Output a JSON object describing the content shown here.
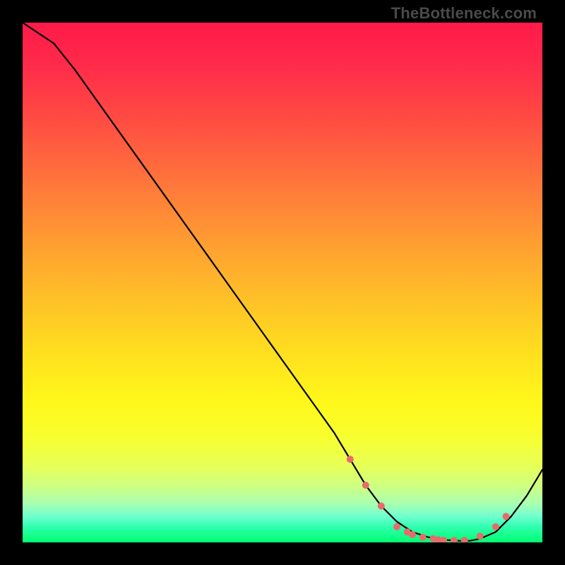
{
  "watermark": "TheBottleneck.com",
  "chart_data": {
    "type": "line",
    "title": "",
    "xlabel": "",
    "ylabel": "",
    "xlim": [
      0,
      100
    ],
    "ylim": [
      0,
      100
    ],
    "grid": false,
    "legend": false,
    "gradient_stops": [
      {
        "pos": 0,
        "color": "#ff1a4a"
      },
      {
        "pos": 20,
        "color": "#ff5042"
      },
      {
        "pos": 44,
        "color": "#ffa330"
      },
      {
        "pos": 65,
        "color": "#ffe31e"
      },
      {
        "pos": 80,
        "color": "#f7ff30"
      },
      {
        "pos": 92,
        "color": "#aaffb0"
      },
      {
        "pos": 100,
        "color": "#00ff70"
      }
    ],
    "series": [
      {
        "name": "bottleneck-curve",
        "color": "#000000",
        "x": [
          0,
          6,
          10,
          15,
          20,
          25,
          30,
          35,
          40,
          45,
          50,
          55,
          60,
          63,
          66,
          69,
          72,
          75,
          78,
          81,
          84,
          86,
          88,
          91,
          94,
          97,
          100
        ],
        "y": [
          100,
          96,
          91,
          84,
          77,
          70,
          63,
          56,
          49,
          42,
          35,
          28,
          21,
          16,
          11,
          7,
          4,
          2,
          1,
          0.5,
          0.3,
          0.3,
          0.7,
          2,
          5,
          9,
          14
        ]
      }
    ],
    "markers": {
      "name": "highlight-points",
      "color": "#e86b6b",
      "radius": 5,
      "x": [
        63,
        66,
        69,
        72,
        74,
        75,
        77,
        79,
        80,
        81,
        83,
        85,
        88,
        91,
        93
      ],
      "y": [
        16,
        11,
        7,
        3,
        2,
        1.5,
        1,
        0.7,
        0.5,
        0.4,
        0.4,
        0.4,
        1.2,
        3,
        5
      ]
    }
  }
}
